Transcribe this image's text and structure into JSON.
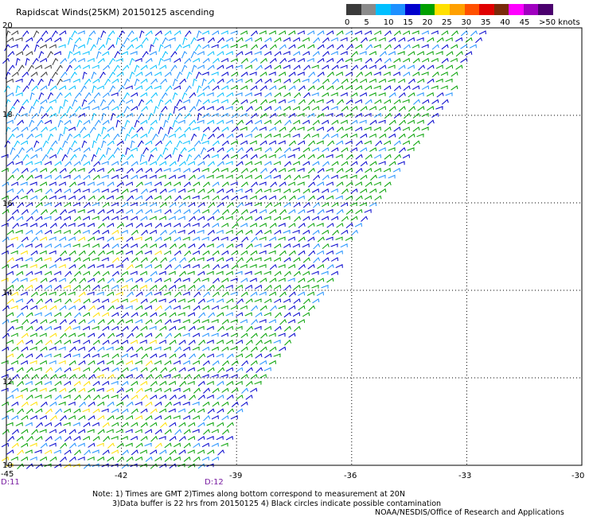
{
  "title": "Rapidscat Winds(25KM) 20150125 ascending",
  "scale": {
    "colors": [
      "#3a3a3a",
      "#8a8a8a",
      "#00bfff",
      "#1e90ff",
      "#0000cd",
      "#00a000",
      "#ffe000",
      "#ffa000",
      "#ff5000",
      "#e00000",
      "#7a2a0a",
      "#ff00ff",
      "#a000c0",
      "#4b006e"
    ],
    "labels": [
      "0",
      "5",
      "10",
      "15",
      "20",
      "25",
      "30",
      "35",
      "40",
      "45",
      ">50 knots"
    ]
  },
  "lat_labels": [
    "20",
    "18",
    "16",
    "14",
    "12",
    "10"
  ],
  "lon_labels": [
    "-45",
    "-42",
    "-39",
    "-36",
    "-33",
    "-30"
  ],
  "time_labels": [
    "D:11",
    "D:12"
  ],
  "notes": {
    "line1": "Note: 1) Times are GMT 2)Times along bottom correspond to measurement at 20N",
    "line2": "3)Data buffer is 22 hrs from 20150125 4) Black circles indicate possible contamination",
    "line3": "NOAA/NESDIS/Office of Research and Applications"
  },
  "chart_data": {
    "type": "wind-barb-map",
    "title": "Rapidscat Winds(25KM) 20150125 ascending",
    "lon_range": [
      -45,
      -30
    ],
    "lat_range": [
      10,
      20
    ],
    "grid": true,
    "speed_scale_knots": [
      0,
      5,
      10,
      15,
      20,
      25,
      30,
      35,
      40,
      45,
      50
    ],
    "swath_edge": [
      [
        -32.2,
        20
      ],
      [
        -39.5,
        10
      ]
    ],
    "time_markers": [
      {
        "label": "D:11",
        "lon": -45
      },
      {
        "label": "D:12",
        "lon": -40
      }
    ]
  }
}
